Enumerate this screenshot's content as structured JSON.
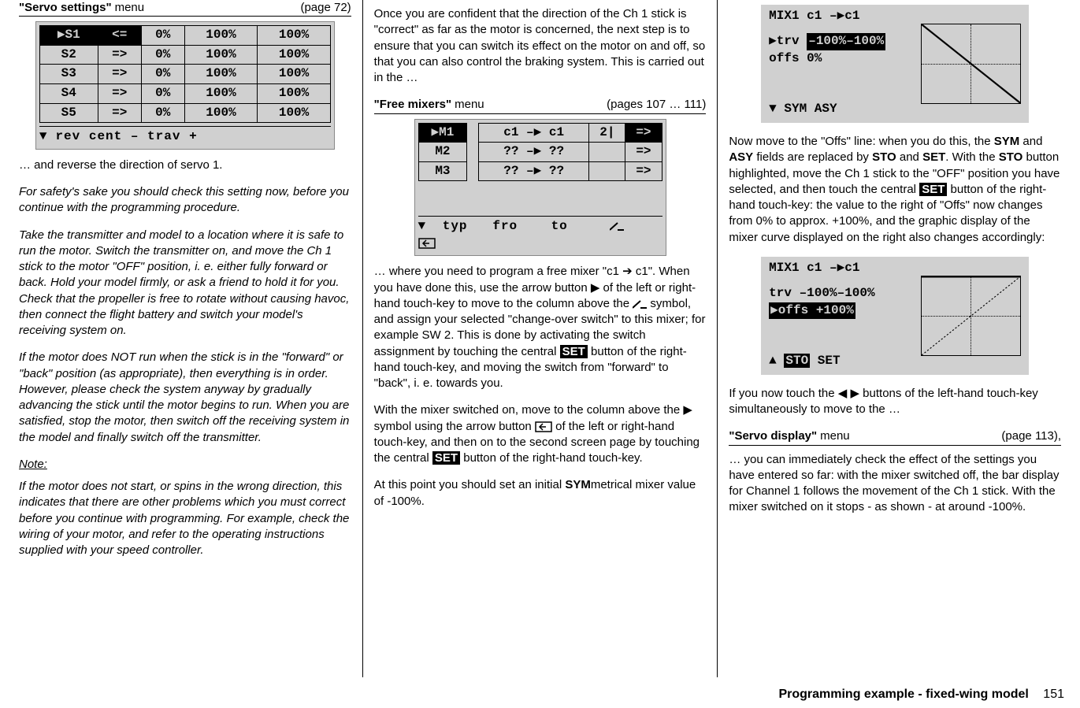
{
  "col1": {
    "menu": {
      "name": "\"Servo settings\"",
      "word": "menu",
      "pref": "(page 72)"
    },
    "servo_table": {
      "rows": [
        {
          "srv": "▶S1",
          "rev": "<=",
          "cent": "0%",
          "t1": "100%",
          "t2": "100%",
          "rev_hl": true,
          "srv_hl": true
        },
        {
          "srv": "S2",
          "rev": "=>",
          "cent": "0%",
          "t1": "100%",
          "t2": "100%"
        },
        {
          "srv": "S3",
          "rev": "=>",
          "cent": "0%",
          "t1": "100%",
          "t2": "100%"
        },
        {
          "srv": "S4",
          "rev": "=>",
          "cent": "0%",
          "t1": "100%",
          "t2": "100%"
        },
        {
          "srv": "S5",
          "rev": "=>",
          "cent": "0%",
          "t1": "100%",
          "t2": "100%"
        }
      ],
      "footer": "rev   cent    –  trav  +"
    },
    "p1": "… and reverse the direction of servo 1.",
    "p2": "For safety's sake you should check this setting now, before you continue with the programming procedure.",
    "p3": "Take the transmitter and model to a location where it is safe to run the motor. Switch the transmitter on, and move the Ch 1 stick to the motor \"OFF\" position, i. e. either fully forward or back. Hold your model firmly, or ask a friend to hold it for you. Check that the propeller is free to rotate without causing havoc, then connect the flight battery and switch your model's receiving system on.",
    "p4": "If the motor does NOT run when the stick is in the \"forward\" or \"back\" position (as appropriate), then everything is in order. However, please check the system anyway by gradually advancing the stick until the motor begins to run. When you are satisfied, stop the motor, then switch off the receiving system in the model and finally switch off the transmitter.",
    "note_label": "Note:",
    "p5": "If the motor does not start, or spins in the wrong direction, this indicates that there are other problems which you must correct before you continue with programming. For example, check the wiring of your motor, and refer to the operating instructions supplied with your speed controller."
  },
  "col2": {
    "p1": "Once you are confident that the direction of the Ch 1 stick is \"correct\" as far as the motor is concerned, the next step is to ensure that you can switch its effect on the motor on and off, so that you can also control the braking system. This is carried out in the …",
    "menu": {
      "name": "\"Free mixers\"",
      "word": "menu",
      "pref": "(pages 107 … 111)"
    },
    "mix_table": {
      "rows": [
        {
          "m": "▶M1",
          "f": "c1",
          "t": "c1",
          "sw": "2|",
          "sym": "=>",
          "m_hl": true,
          "sym_hl": true
        },
        {
          "m": "M2",
          "f": "??",
          "t": "??",
          "sw": "",
          "sym": "=>"
        },
        {
          "m": "M3",
          "f": "??",
          "t": "??",
          "sw": "",
          "sym": "=>"
        }
      ],
      "footer_parts": [
        "typ",
        "fro",
        "to"
      ]
    },
    "p2a": "… where you need to program a free mixer \"c1 ➔ c1\". When you have done this, use the arrow button ▶ of the left or right-hand touch-key to move to the column above the ",
    "p2b": " symbol, and assign your selected \"change-over switch\" to this mixer; for example SW 2. This is done by activating the switch assignment by touching the central ",
    "p2c": " button of the right-hand touch-key, and moving the switch from \"forward\" to \"back\", i. e. towards you.",
    "p3a": "With the mixer switched on, move to the column above the ▶ symbol using the arrow button ",
    "p3b": " of the left or right-hand touch-key, and then on to the second screen page by touching the central ",
    "p3c": " button of the right-hand touch-key.",
    "p4_pre": "At this point you should set an initial ",
    "p4_bold": "SYM",
    "p4_post": "metrical mixer value of -100%.",
    "set_label": "SET"
  },
  "col3": {
    "mix1": {
      "title": "MIX1    c1 –▶c1",
      "row1": "▶trv –100%–100%",
      "row1_hl": "–100%–100%",
      "row2": "  offs        0%",
      "foot": "▼    SYM ASY"
    },
    "p1_pre": "Now move to the \"Offs\" line: when you do this, the ",
    "p1_b1": "SYM",
    "p1_mid1": " and ",
    "p1_b2": "ASY",
    "p1_mid2": " fields are replaced by ",
    "p1_b3": "STO",
    "p1_mid3": " and ",
    "p1_b4": "SET",
    "p1_mid4": ". With the ",
    "p1_b5": "STO",
    "p1_mid5": " button highlighted, move the Ch 1 stick to the \"OFF\" position you have selected, and then touch the central ",
    "p1_mid6": " button of the right-hand touch-key: the value to the right of \"Offs\" now changes from 0% to approx. +100%, and the graphic display of the mixer curve displayed on the right also changes accordingly:",
    "mix2": {
      "title": "MIX1    c1 –▶c1",
      "row1": "  trv –100%–100%",
      "row2": "▶offs   +100%",
      "foot_pre": "▲    ",
      "foot_sto": "STO",
      "foot_post": " SET"
    },
    "p2": "If you now touch the ◀ ▶ buttons of the left-hand touch-key simultaneously to move to the …",
    "menu": {
      "name": "\"Servo display\"",
      "word": "menu",
      "pref": "(page 113),"
    },
    "p3": "… you can immediately check the effect of the settings you have entered so far: with the mixer switched off, the bar display for Channel 1 follows the movement of the Ch 1 stick. With the mixer switched on it stops - as shown - at around -100%."
  },
  "footer": {
    "title": "Programming example - fixed-wing model",
    "num": "151"
  }
}
